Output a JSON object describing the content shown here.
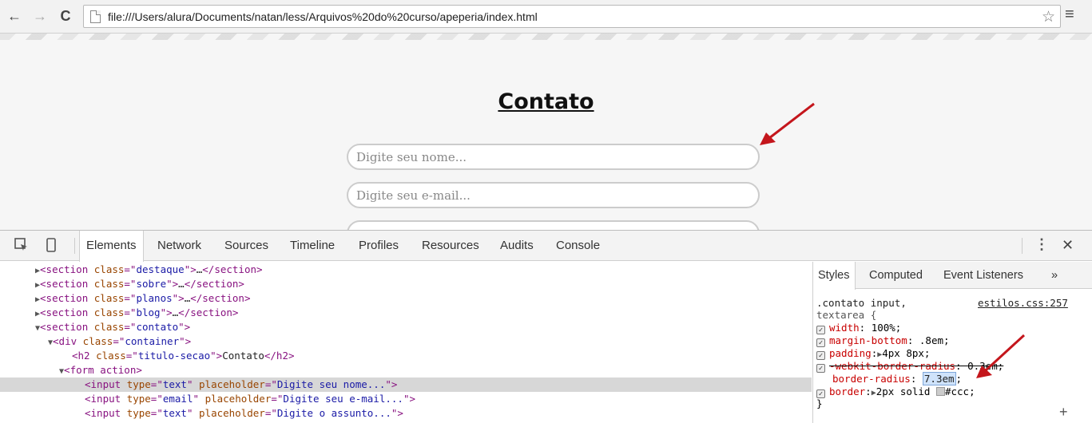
{
  "browser": {
    "url": "file:///Users/alura/Documents/natan/less/Arquivos%20do%20curso/apeperia/index.html",
    "back_glyph": "←",
    "forward_glyph": "→",
    "reload_glyph": "C",
    "star_glyph": "☆",
    "menu_glyph": "≡"
  },
  "page": {
    "title": "Contato",
    "fields": [
      {
        "placeholder": "Digite seu nome..."
      },
      {
        "placeholder": "Digite seu e-mail..."
      }
    ]
  },
  "devtools": {
    "tabs": [
      "Elements",
      "Network",
      "Sources",
      "Timeline",
      "Profiles",
      "Resources",
      "Audits",
      "Console"
    ],
    "active_tab": "Elements",
    "kebab_glyph": "⋮",
    "close_glyph": "✕",
    "dom": {
      "sections": [
        {
          "cls": "destaque"
        },
        {
          "cls": "sobre"
        },
        {
          "cls": "planos"
        },
        {
          "cls": "blog"
        }
      ],
      "contato_cls": "contato",
      "container_cls": "container",
      "h2_cls": "titulo-secao",
      "h2_text": "Contato",
      "form_tag": "form action",
      "inputs": [
        {
          "type": "text",
          "placeholder": "Digite seu nome..."
        },
        {
          "type": "email",
          "placeholder": "Digite seu e-mail..."
        },
        {
          "type": "text",
          "placeholder": "Digite o assunto..."
        }
      ]
    },
    "styles": {
      "tabs": [
        "Styles",
        "Computed",
        "Event Listeners"
      ],
      "more_glyph": "»",
      "selector_line1": ".contato input,",
      "selector_line2": "textarea {",
      "source": "estilos.css:257",
      "rules": [
        {
          "prop": "width",
          "value": "100%;"
        },
        {
          "prop": "margin-bottom",
          "value": ".8em;"
        },
        {
          "prop": "padding",
          "value": "4px 8px;"
        },
        {
          "prop": "-webkit-border-radius",
          "value": "0.3em;"
        },
        {
          "prop": "border-radius",
          "value": "7.3em"
        },
        {
          "prop": "border",
          "value": "2px solid",
          "value2": "#ccc;"
        }
      ],
      "close_brace": "}",
      "plus_glyph": "+"
    }
  },
  "colors": {
    "arrow": "#c4161c",
    "field_border": "#cccccc"
  }
}
